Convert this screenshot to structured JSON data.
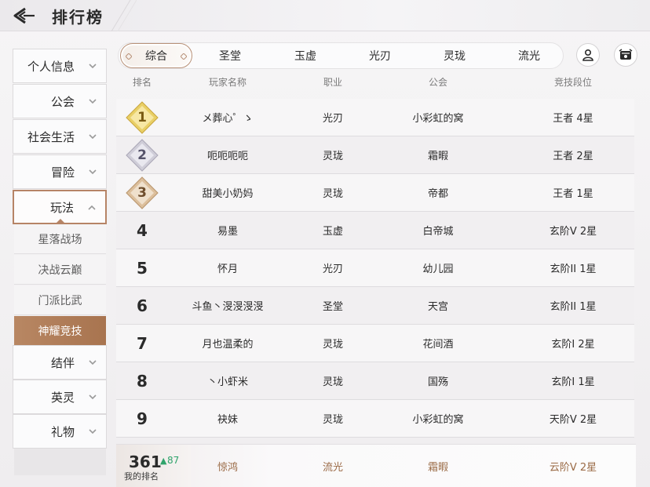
{
  "header": {
    "title": "排行榜"
  },
  "sidebar": {
    "items": [
      {
        "label": "个人信息"
      },
      {
        "label": "公会"
      },
      {
        "label": "社会生活"
      },
      {
        "label": "冒险"
      },
      {
        "label": "玩法"
      },
      {
        "label": "结伴"
      },
      {
        "label": "英灵"
      },
      {
        "label": "礼物"
      }
    ],
    "subitems": [
      {
        "label": "星落战场"
      },
      {
        "label": "决战云巅"
      },
      {
        "label": "门派比武"
      },
      {
        "label": "神耀竞技"
      }
    ]
  },
  "tabs": [
    {
      "label": "综合"
    },
    {
      "label": "圣堂"
    },
    {
      "label": "玉虚"
    },
    {
      "label": "光刃"
    },
    {
      "label": "灵珑"
    },
    {
      "label": "流光"
    }
  ],
  "table": {
    "headers": {
      "rank": "排名",
      "name": "玩家名称",
      "job": "职业",
      "guild": "公会",
      "tier": "竞技段位"
    },
    "rows": [
      {
        "rank": "1",
        "name": "メ葬心゜ゝ",
        "job": "光刃",
        "guild": "小彩虹的窝",
        "tier": "王者 4星"
      },
      {
        "rank": "2",
        "name": "呃呃呃呃",
        "job": "灵珑",
        "guild": "霜暇",
        "tier": "王者 2星"
      },
      {
        "rank": "3",
        "name": "甜美小奶妈",
        "job": "灵珑",
        "guild": "帝都",
        "tier": "王者 1星"
      },
      {
        "rank": "4",
        "name": "易墨",
        "job": "玉虚",
        "guild": "白帝城",
        "tier": "玄阶V 2星"
      },
      {
        "rank": "5",
        "name": "怀月",
        "job": "光刃",
        "guild": "幼儿园",
        "tier": "玄阶II 1星"
      },
      {
        "rank": "6",
        "name": "斗鱼丶渂渂渂渂",
        "job": "圣堂",
        "guild": "天宫",
        "tier": "玄阶II 1星"
      },
      {
        "rank": "7",
        "name": "月也温柔的",
        "job": "灵珑",
        "guild": "花间酒",
        "tier": "玄阶I 2星"
      },
      {
        "rank": "8",
        "name": "丶小虾米",
        "job": "灵珑",
        "guild": "国殇",
        "tier": "玄阶I 1星"
      },
      {
        "rank": "9",
        "name": "袂妹",
        "job": "灵珑",
        "guild": "小彩虹的窝",
        "tier": "天阶V 2星"
      }
    ]
  },
  "my_rank": {
    "rank": "361",
    "change": "87",
    "label": "我的排名",
    "name": "惊鸿",
    "job": "流光",
    "guild": "霜暇",
    "tier": "云阶V 2星"
  },
  "colors": {
    "accent": "#b68466",
    "selected_sub": "#b0805a",
    "up_green": "#2fa36b",
    "my_row_text": "#9a6a45"
  }
}
